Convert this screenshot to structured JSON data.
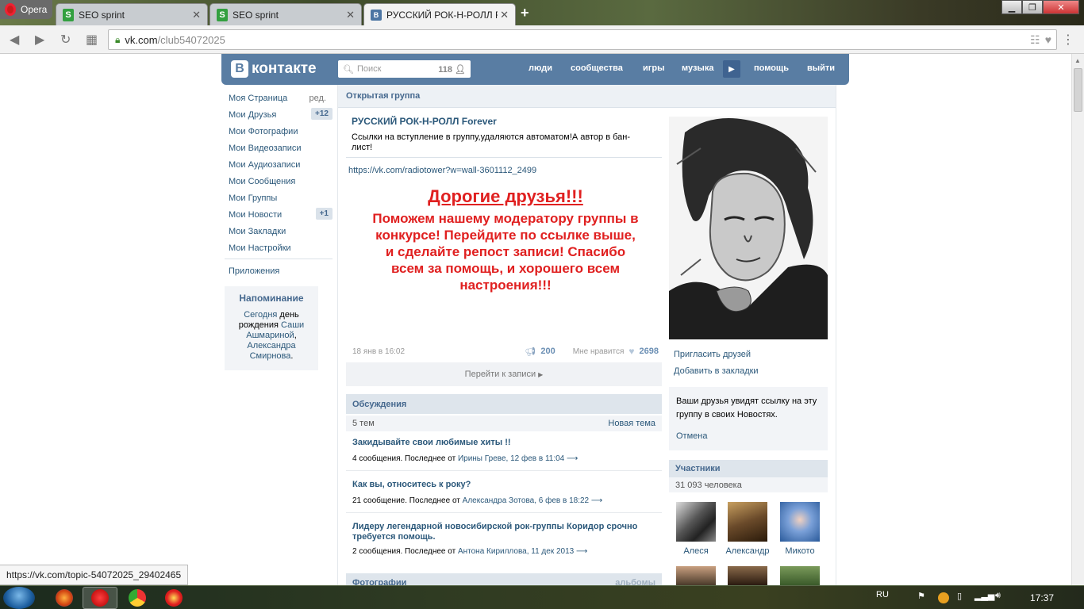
{
  "browser": {
    "menu_label": "Opera",
    "tabs": [
      {
        "title": "SEO sprint",
        "icon": "seosprint-icon"
      },
      {
        "title": "SEO sprint",
        "icon": "seosprint-icon"
      },
      {
        "title": "РУССКИЙ РОК-Н-РОЛЛ F",
        "icon": "vk-icon"
      }
    ],
    "address_host": "vk.com",
    "address_path": "/club54072025",
    "status_url": "https://vk.com/topic-54072025_29402465"
  },
  "vk": {
    "logo_text": "контакте",
    "logo_letter": "B",
    "search_placeholder": "Поиск",
    "search_count": "118",
    "nav": [
      "люди",
      "сообщества",
      "игры",
      "музыка",
      "помощь",
      "выйти"
    ]
  },
  "left_menu": {
    "items": [
      {
        "label": "Моя Страница",
        "extra": "ред."
      },
      {
        "label": "Мои Друзья",
        "badge": "+12"
      },
      {
        "label": "Мои Фотографии"
      },
      {
        "label": "Мои Видеозаписи"
      },
      {
        "label": "Мои Аудиозаписи"
      },
      {
        "label": "Мои Сообщения"
      },
      {
        "label": "Мои Группы"
      },
      {
        "label": "Мои Новости",
        "badge": "+1"
      },
      {
        "label": "Мои Закладки"
      },
      {
        "label": "Мои Настройки"
      }
    ],
    "apps": "Приложения",
    "reminder": {
      "title": "Напоминание",
      "t1": "Сегодня",
      "t2": " день рождения ",
      "n1": "Саши Ашмариной",
      "t3": ", ",
      "n2": "Александра Смирнова",
      "t4": "."
    }
  },
  "group": {
    "type": "Открытая группа",
    "title": "РУССКИЙ РОК-Н-РОЛЛ Forever",
    "status": "Ссылки на вступление в группу,удаляются автоматом!А автор в бан-лист!",
    "post_link": "https://vk.com/radiotower?w=wall-3601112_2499",
    "post_heading": "Дорогие друзья!!!",
    "post_body": "Поможем нашему модератору группы в конкурсе! Перейдите по ссылке выше, и сделайте репост записи! Спасибо всем за помощь, и хорошего всем настроения!!!",
    "post_date": "18 янв в 16:02",
    "reposts": "200",
    "like_label": "Мне нравится",
    "likes": "2698",
    "goto_post": "Перейти к записи"
  },
  "discussions": {
    "title": "Обсуждения",
    "count": "5 тем",
    "new_topic": "Новая тема",
    "topics": [
      {
        "title": "Закидывайте свои любимые хиты !!",
        "meta": "4 сообщения. Последнее от ",
        "author": "Ирины Греве",
        "date": ", 12 фев в 11:04"
      },
      {
        "title": "Как вы, относитесь к року?",
        "meta": "21 сообщение. Последнее от ",
        "author": "Александра Зотова",
        "date": ", 6 фев в 18:22"
      },
      {
        "title": "Лидеру легендарной новосибирской рок-группы Коридор срочно требуется помощь.",
        "meta": "2 сообщения. Последнее от ",
        "author": "Антона Кириллова",
        "date": ", 11 дек 2013"
      }
    ]
  },
  "photos": {
    "title": "Фотографии",
    "albums": "альбомы"
  },
  "sidebar": {
    "invite": "Пригласить друзей",
    "bookmark": "Добавить в закладки",
    "share_text": "Ваши друзья увидят ссылку на эту группу в своих Новостях.",
    "cancel": "Отмена",
    "members_title": "Участники",
    "members_count": "31 093 человека",
    "members": [
      "Алеся",
      "Александр",
      "Микото"
    ]
  },
  "taskbar": {
    "lang": "RU",
    "time": "17:37"
  }
}
